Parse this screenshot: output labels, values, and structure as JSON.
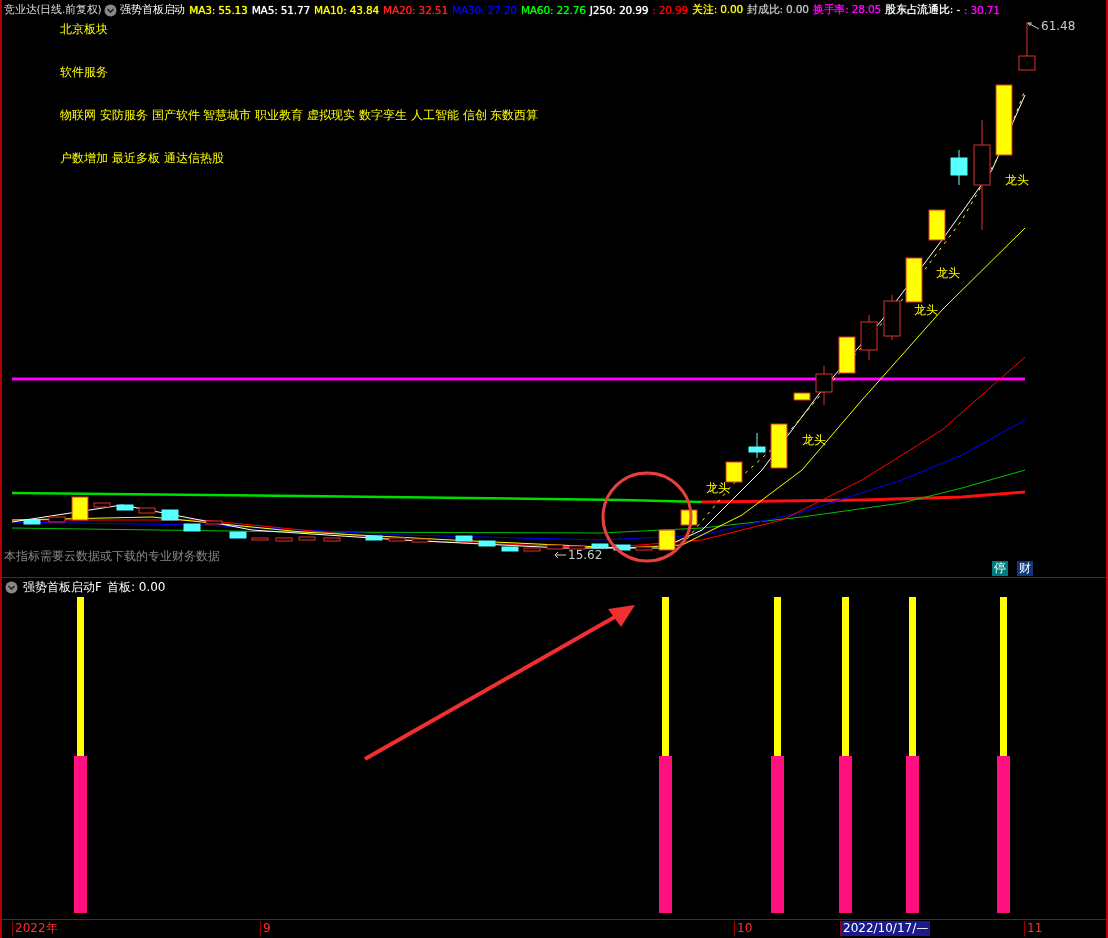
{
  "header": {
    "title": "竞业达(日线.前复权)",
    "indicator": "强势首板启动",
    "values": [
      {
        "text": "MA3: 55.13",
        "color": "#ffff00"
      },
      {
        "text": "MA5: 51.77",
        "color": "#ffffff"
      },
      {
        "text": "MA10: 43.84",
        "color": "#ffff00"
      },
      {
        "text": "MA20: 32.51",
        "color": "#ff2020"
      },
      {
        "text": "MA30: 27.20",
        "color": "#0000ff"
      },
      {
        "text": "MA60: 22.76",
        "color": "#00ff00"
      },
      {
        "text": "J250: 20.99",
        "color": "#ffffff"
      },
      {
        "text": ": 20.99",
        "color": "#ff0000"
      },
      {
        "text": "关注: 0.00",
        "color": "#ffff00"
      },
      {
        "text": "封成比: 0.00",
        "color": "#c0c0c0"
      },
      {
        "text": "换手率: 28.05",
        "color": "#ff00ff"
      },
      {
        "text": "股东占流通比: -",
        "color": "#ffffff"
      },
      {
        "text": ": 30.71",
        "color": "#ff00ff"
      }
    ]
  },
  "sector_tags": [
    "北京板块",
    "软件服务",
    "物联网 安防服务 国产软件 智慧城市 职业教育 虚拟现实 数字孪生 人工智能 信创 东数西算",
    "户数增加 最近多板 通达信热股"
  ],
  "price_labels": {
    "high": "61.48",
    "low": "15.62"
  },
  "annotations": [
    "龙头",
    "龙头",
    "龙头",
    "龙头",
    "龙头"
  ],
  "note": "本指标需要云数据或下载的专业财务数据",
  "badges": [
    {
      "text": "停",
      "color": "#007b7b"
    },
    {
      "text": "财",
      "color": "#0a3a7a"
    }
  ],
  "sub_panel": {
    "indicator": "强势首板启动F",
    "reading": "首板: 0.00"
  },
  "time_axis": [
    {
      "label": "2022年",
      "selected": false
    },
    {
      "label": "9",
      "selected": false
    },
    {
      "label": "10",
      "selected": false
    },
    {
      "label": "2022/10/17/—",
      "selected": true
    },
    {
      "label": "11",
      "selected": false
    }
  ]
}
